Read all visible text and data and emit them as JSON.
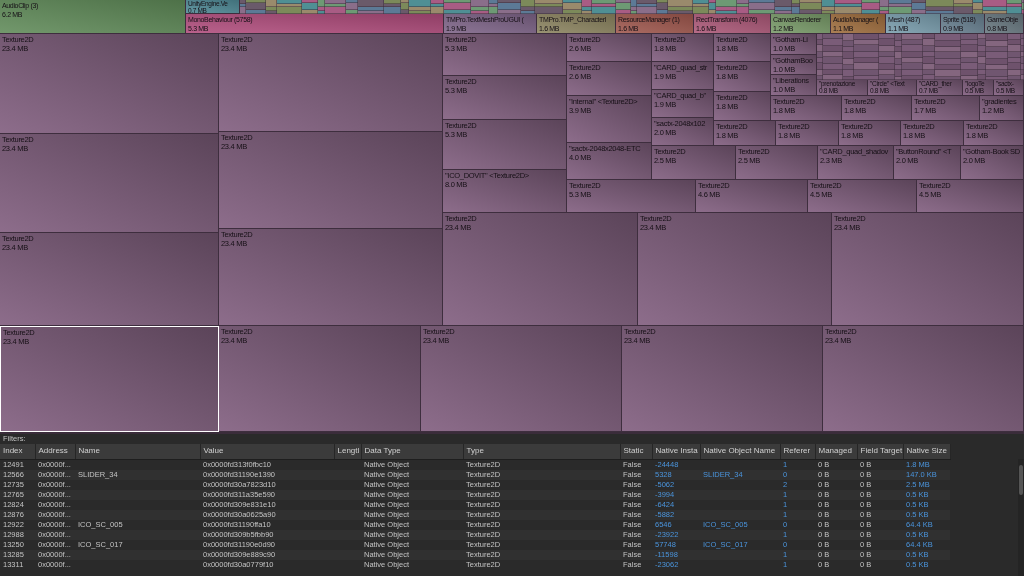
{
  "type_groups": [
    {
      "label": "AudioClip (3)",
      "size": "6.2 MB",
      "color": "#5f8a58"
    },
    {
      "label": "UnityEngine.Ve",
      "size": "0.7 MB",
      "color": "#4f8a96"
    },
    {
      "label": "MonoBehaviour (5758)",
      "size": "5.3 MB",
      "color": "#b04c7c"
    },
    {
      "label": "TMPro.TextMeshProUGUI (",
      "size": "1.9 MB",
      "color": "#7e6488"
    },
    {
      "label": "TMPro.TMP_Characterl",
      "size": "1.6 MB",
      "color": "#8c8460"
    },
    {
      "label": "ResourceManager (1)",
      "size": "1.6 MB",
      "color": "#a0584e"
    },
    {
      "label": "RectTransform (4076)",
      "size": "1.6 MB",
      "color": "#ac5878"
    },
    {
      "label": "CanvasRenderer",
      "size": "1.2 MB",
      "color": "#789a68"
    },
    {
      "label": "AudioManager (",
      "size": "1.1 MB",
      "color": "#a06e3e"
    },
    {
      "label": "Mesh (487)",
      "size": "1.1 MB",
      "color": "#7a9eae"
    },
    {
      "label": "Sprite (518)",
      "size": "0.9 MB",
      "color": "#688090"
    },
    {
      "label": "GameObje",
      "size": "0.8 MB",
      "color": "#687880"
    }
  ],
  "treemap_cells": [
    {
      "label": "Texture2D",
      "size": "23.4 MB",
      "selected": false
    },
    {
      "label": "Texture2D",
      "size": "23.4 MB",
      "selected": false
    },
    {
      "label": "Texture2D",
      "size": "23.4 MB",
      "selected": false
    },
    {
      "label": "Texture2D",
      "size": "23.4 MB",
      "selected": true
    },
    {
      "label": "Texture2D",
      "size": "23.4 MB",
      "selected": false
    },
    {
      "label": "Texture2D",
      "size": "23.4 MB",
      "selected": false
    },
    {
      "label": "Texture2D",
      "size": "23.4 MB",
      "selected": false
    },
    {
      "label": "Texture2D",
      "size": "23.4 MB",
      "selected": false
    },
    {
      "label": "Texture2D",
      "size": "23.4 MB",
      "selected": false
    },
    {
      "label": "Texture2D",
      "size": "23.4 MB",
      "selected": false
    },
    {
      "label": "Texture2D",
      "size": "23.4 MB",
      "selected": false
    },
    {
      "label": "Texture2D",
      "size": "23.4 MB",
      "selected": false
    },
    {
      "label": "Texture2D",
      "size": "23.4 MB",
      "selected": false
    },
    {
      "label": "Texture2D",
      "size": "23.4 MB",
      "selected": false
    },
    {
      "label": "Texture2D",
      "size": "5.3 MB",
      "selected": false
    },
    {
      "label": "Texture2D",
      "size": "5.3 MB",
      "selected": false
    },
    {
      "label": "Texture2D",
      "size": "5.3 MB",
      "selected": false
    },
    {
      "label": "\"ICO_DOVIT\" <Texture2D>",
      "size": "8.0 MB",
      "selected": false
    },
    {
      "label": "Texture2D",
      "size": "2.6 MB",
      "selected": false
    },
    {
      "label": "Texture2D",
      "size": "2.6 MB",
      "selected": false
    },
    {
      "label": "\"internal\" <Texture2D>",
      "size": "3.9 MB",
      "selected": false
    },
    {
      "label": "\"sactx-2048x2048-ETC",
      "size": "4.0 MB",
      "selected": false
    },
    {
      "label": "Texture2D",
      "size": "1.8 MB",
      "selected": false
    },
    {
      "label": "\"CARD_quad_str",
      "size": "1.9 MB",
      "selected": false
    },
    {
      "label": "\"CARD_quad_b\"",
      "size": "1.9 MB",
      "selected": false
    },
    {
      "label": "\"sactx-2048x102",
      "size": "2.0 MB",
      "selected": false
    },
    {
      "label": "Texture2D",
      "size": "1.8 MB",
      "selected": false
    },
    {
      "label": "Texture2D",
      "size": "1.8 MB",
      "selected": false
    },
    {
      "label": "Texture2D",
      "size": "1.8 MB",
      "selected": false
    },
    {
      "label": "\"Gotham-Li",
      "size": "1.0 MB",
      "selected": false
    },
    {
      "label": "\"GothamBoo",
      "size": "1.0 MB",
      "selected": false
    },
    {
      "label": "\"Liberations",
      "size": "1.0 MB",
      "selected": false
    },
    {
      "label": "\"prenotazione",
      "size": "0.8 MB",
      "selected": false
    },
    {
      "label": "\"Circle\" <Text",
      "size": "0.8 MB",
      "selected": false
    },
    {
      "label": "\"CARD_ther",
      "size": "0.7 MB",
      "selected": false
    },
    {
      "label": "\"logoTe",
      "size": "0.5 MB",
      "selected": false
    },
    {
      "label": "\"sactx-",
      "size": "0.5 MB",
      "selected": false
    },
    {
      "label": "Texture2D",
      "size": "1.8 MB",
      "selected": false
    },
    {
      "label": "Texture2D",
      "size": "1.8 MB",
      "selected": false
    },
    {
      "label": "Texture2D",
      "size": "1.7 MB",
      "selected": false
    },
    {
      "label": "\"gradientes",
      "size": "1.2 MB",
      "selected": false
    },
    {
      "label": "Texture2D",
      "size": "1.8 MB",
      "selected": false
    },
    {
      "label": "Texture2D",
      "size": "1.8 MB",
      "selected": false
    },
    {
      "label": "Texture2D",
      "size": "1.8 MB",
      "selected": false
    },
    {
      "label": "Texture2D",
      "size": "1.8 MB",
      "selected": false
    },
    {
      "label": "Texture2D",
      "size": "1.8 MB",
      "selected": false
    },
    {
      "label": "Texture2D",
      "size": "2.5 MB",
      "selected": false
    },
    {
      "label": "Texture2D",
      "size": "2.5 MB",
      "selected": false
    },
    {
      "label": "\"CARD_quad_shadov",
      "size": "2.3 MB",
      "selected": false
    },
    {
      "label": "\"ButtonRound\" <T",
      "size": "2.0 MB",
      "selected": false
    },
    {
      "label": "\"Gotham-Book SD",
      "size": "2.0 MB",
      "selected": false
    },
    {
      "label": "Texture2D",
      "size": "5.3 MB",
      "selected": false
    },
    {
      "label": "Texture2D",
      "size": "4.6 MB",
      "selected": false
    },
    {
      "label": "Texture2D",
      "size": "4.5 MB",
      "selected": false
    },
    {
      "label": "Texture2D",
      "size": "4.5 MB",
      "selected": false
    }
  ],
  "filters_label": "Filters:",
  "table": {
    "columns": [
      "Index",
      "Address",
      "Name",
      "Value",
      "Lengtl",
      "Data Type",
      "Type",
      "Static",
      "Native Insta",
      "Native Object Name",
      "Referer",
      "Managed",
      "Field Target",
      "Native Size"
    ],
    "rows": [
      [
        "12491",
        "0x0000f...",
        "",
        "0x0000fd313f0fbc10",
        "",
        "Native Object",
        "Texture2D",
        "False",
        "-24448",
        "",
        "1",
        "0 B",
        "0 B",
        "1.8 MB"
      ],
      [
        "12566",
        "0x0000f...",
        "SLIDER_34",
        "0x0000fd31190e1390",
        "",
        "Native Object",
        "Texture2D",
        "False",
        "5328",
        "SLIDER_34",
        "0",
        "0 B",
        "0 B",
        "147.0 KB"
      ],
      [
        "12735",
        "0x0000f...",
        "",
        "0x0000fd30a7823d10",
        "",
        "Native Object",
        "Texture2D",
        "False",
        "-5062",
        "",
        "2",
        "0 B",
        "0 B",
        "2.5 MB"
      ],
      [
        "12765",
        "0x0000f...",
        "",
        "0x0000fd311a35e590",
        "",
        "Native Object",
        "Texture2D",
        "False",
        "-3994",
        "",
        "1",
        "0 B",
        "0 B",
        "0.5 KB"
      ],
      [
        "12824",
        "0x0000f...",
        "",
        "0x0000fd309e831e10",
        "",
        "Native Object",
        "Texture2D",
        "False",
        "-6424",
        "",
        "1",
        "0 B",
        "0 B",
        "0.5 KB"
      ],
      [
        "12876",
        "0x0000f...",
        "",
        "0x0000fd30a0625a90",
        "",
        "Native Object",
        "Texture2D",
        "False",
        "-5882",
        "",
        "1",
        "0 B",
        "0 B",
        "0.5 KB"
      ],
      [
        "12922",
        "0x0000f...",
        "ICO_SC_005",
        "0x0000fd31190ffa10",
        "",
        "Native Object",
        "Texture2D",
        "False",
        "6546",
        "ICO_SC_005",
        "0",
        "0 B",
        "0 B",
        "64.4 KB"
      ],
      [
        "12988",
        "0x0000f...",
        "",
        "0x0000fd309b5fbb90",
        "",
        "Native Object",
        "Texture2D",
        "False",
        "-23922",
        "",
        "1",
        "0 B",
        "0 B",
        "0.5 KB"
      ],
      [
        "13250",
        "0x0000f...",
        "ICO_SC_017",
        "0x0000fd31190e0d90",
        "",
        "Native Object",
        "Texture2D",
        "False",
        "57748",
        "ICO_SC_017",
        "0",
        "0 B",
        "0 B",
        "64.4 KB"
      ],
      [
        "13285",
        "0x0000f...",
        "",
        "0x0000fd309e889c90",
        "",
        "Native Object",
        "Texture2D",
        "False",
        "-11598",
        "",
        "1",
        "0 B",
        "0 B",
        "0.5 KB"
      ],
      [
        "13311",
        "0x0000f...",
        "",
        "0x0000fd30a0779f10",
        "",
        "Native Object",
        "Texture2D",
        "False",
        "-23062",
        "",
        "1",
        "0 B",
        "0 B",
        "0.5 KB"
      ]
    ]
  }
}
